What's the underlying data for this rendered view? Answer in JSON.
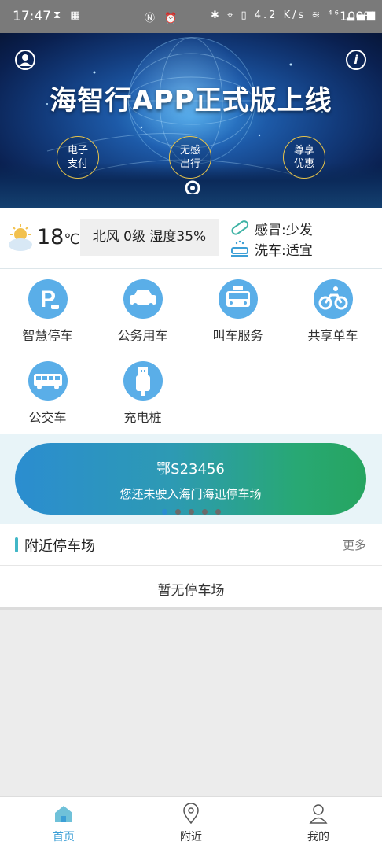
{
  "status_bar": {
    "time": "17:47",
    "left_icons": "⧗ ▦",
    "center_icons": "Ⓝ ⏰",
    "right_icons": "✱ ⌖ ▯ 4.2 K/s ≋ ⁴⁶ ▂▄▆",
    "battery": "100%"
  },
  "banner": {
    "title": "海智行APP正式版上线",
    "badges": [
      "电子\n支付",
      "无感\n出行",
      "尊享\n优惠"
    ],
    "profile_icon": "user-icon",
    "info_icon": "info-icon",
    "info_glyph": "i"
  },
  "weather": {
    "temperature": "18",
    "unit": "℃",
    "details": "北风 0级 湿度35%",
    "cold_tip": "感冒:少发",
    "wash_tip": "洗车:适宜"
  },
  "services": [
    {
      "label": "智慧停车",
      "icon": "parking-icon"
    },
    {
      "label": "公务用车",
      "icon": "car-icon"
    },
    {
      "label": "叫车服务",
      "icon": "taxi-icon"
    },
    {
      "label": "共享单车",
      "icon": "bicycle-icon"
    },
    {
      "label": "公交车",
      "icon": "bus-icon"
    },
    {
      "label": "充电桩",
      "icon": "charger-icon"
    }
  ],
  "parking_card": {
    "plate": "鄂S23456",
    "message": "您还未驶入海门海迅停车场"
  },
  "carousel": {
    "count": 5,
    "active": 0
  },
  "nearby": {
    "title": "附近停车场",
    "more": "更多",
    "empty": "暂无停车场"
  },
  "tabbar": {
    "tabs": [
      {
        "label": "首页",
        "icon": "home-icon"
      },
      {
        "label": "附近",
        "icon": "location-icon"
      },
      {
        "label": "我的",
        "icon": "profile-icon"
      }
    ]
  },
  "colors": {
    "accent": "#3c9fd6",
    "icon_bg": "#5aaee8",
    "card_start": "#2b8dd0",
    "card_end": "#26a560"
  }
}
